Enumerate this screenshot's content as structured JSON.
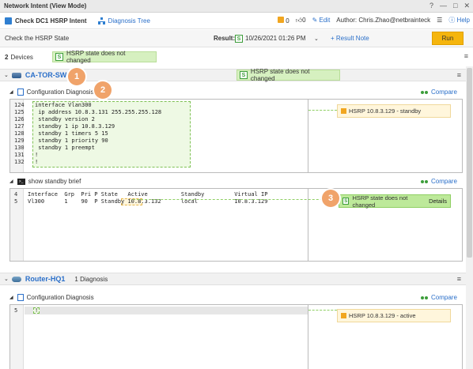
{
  "window": {
    "title": "Network Intent (View Mode)",
    "controls": [
      "?",
      "—",
      "□",
      "✕"
    ]
  },
  "toolbar": {
    "intent_name": "Check DC1 HSRP Intent",
    "diagnosis_tree": "Diagnosis Tree",
    "count_a": "0",
    "count_b": "0",
    "edit": "Edit",
    "author": "Author: Chris.Zhao@netbrainteck",
    "help": "Help"
  },
  "subbar": {
    "description": "Check the HSRP State",
    "result_label": "Result:",
    "result_value": "10/26/2021 01:26 PM",
    "result_note": "+ Result Note",
    "run": "Run"
  },
  "devices_bar": {
    "count": "2",
    "count_label": "Devices",
    "status": "HSRP state does not changed"
  },
  "devices": [
    {
      "name": "CA-TOR-SW1",
      "status": "HSRP state does not changed",
      "sections": [
        {
          "title": "Configuration Diagnosis",
          "compare": "Compare",
          "lines": [
            {
              "n": "124",
              "t": "interface Vlan300"
            },
            {
              "n": "125",
              "t": " ip address 10.8.3.131 255.255.255.128"
            },
            {
              "n": "126",
              "t": " standby version 2"
            },
            {
              "n": "127",
              "t": " standby 1 ip 10.8.3.129"
            },
            {
              "n": "128",
              "t": " standby 1 timers 5 15"
            },
            {
              "n": "129",
              "t": " standby 1 priority 90"
            },
            {
              "n": "130",
              "t": " standby 1 preempt"
            },
            {
              "n": "131",
              "t": "!"
            },
            {
              "n": "132",
              "t": "!"
            }
          ],
          "note": "HSRP 10.8.3.129 - standby"
        },
        {
          "title": "show standby brief",
          "compare": "Compare",
          "lines": [
            {
              "n": "4",
              "t": "Interface  Grp  Pri P State   Active          Standby         Virtual IP"
            },
            {
              "n": "5",
              "t": "Vl300      1    90  P Standby 10.8.3.132      local           10.8.3.129"
            }
          ],
          "note": "HSRP state does not changed",
          "note_link": "Details"
        }
      ]
    },
    {
      "name": "Router-HQ1",
      "diagnosis_count": "1 Diagnosis",
      "sections": [
        {
          "title": "Configuration Diagnosis",
          "compare": "Compare",
          "lines": [
            {
              "n": "5",
              "t": "!"
            }
          ],
          "note": "HSRP 10.8.3.129 - active"
        }
      ]
    }
  ],
  "callouts": [
    "1",
    "2",
    "3"
  ],
  "colors": {
    "accent": "#2a6fc9",
    "run": "#f5b50d",
    "ok_green": "#d6f0c0",
    "callout": "#f0a36a"
  }
}
